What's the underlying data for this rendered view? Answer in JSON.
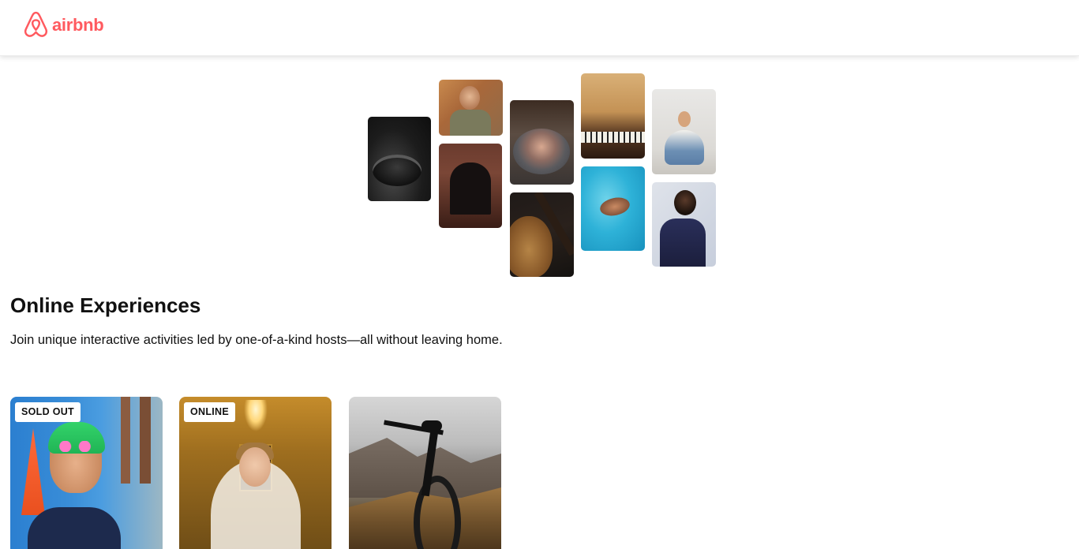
{
  "header": {
    "brand": "airbnb",
    "brand_color": "#FF5A5F"
  },
  "collage": {
    "photos": [
      {
        "name": "cooking-pan-photo"
      },
      {
        "name": "woman-portrait-photo"
      },
      {
        "name": "dancer-doorway-photo"
      },
      {
        "name": "food-bowl-photo"
      },
      {
        "name": "guitar-player-photo"
      },
      {
        "name": "keyboard-microphone-photo"
      },
      {
        "name": "swimmer-pool-photo"
      },
      {
        "name": "yoga-meditation-photo"
      },
      {
        "name": "singer-microphone-photo"
      }
    ]
  },
  "main": {
    "title": "Online Experiences",
    "subtitle": "Join unique interactive activities led by one-of-a-kind hosts—all without leaving home."
  },
  "cards": [
    {
      "badge": "SOLD OUT",
      "image": "swimmer-portrait"
    },
    {
      "badge": "ONLINE",
      "image": "bride-portrait"
    },
    {
      "badge": "",
      "image": "mountain-bike"
    }
  ]
}
